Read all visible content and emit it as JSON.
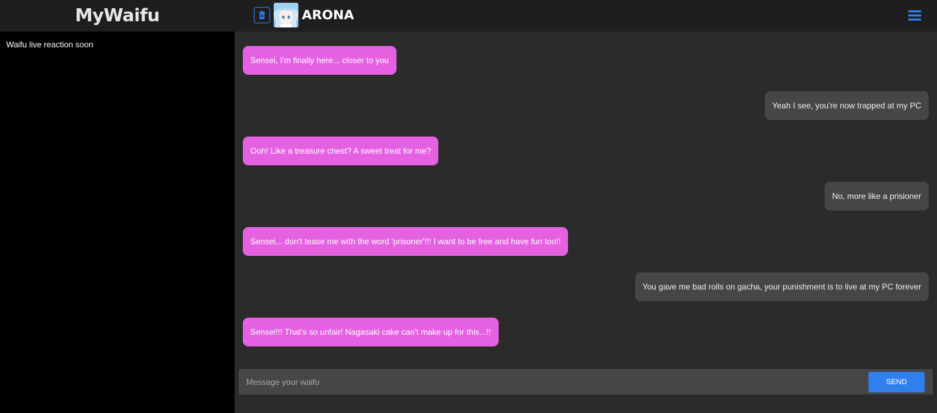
{
  "app": {
    "title": "MyWaifu"
  },
  "header": {
    "character_name": "ARONA"
  },
  "side_panel": {
    "note": "Waifu live reaction soon"
  },
  "messages": [
    {
      "role": "bot",
      "text": "Sensei, I'm finally here... closer to you"
    },
    {
      "role": "user",
      "text": "Yeah I see, you're now trapped at my PC"
    },
    {
      "role": "bot",
      "text": "Ooh! Like a treasure chest? A sweet treat for me?"
    },
    {
      "role": "user",
      "text": "No, more like a prisioner"
    },
    {
      "role": "bot",
      "text": "Sensei... don't tease me with the word 'prisoner'!!! I want to be free and have fun too!!"
    },
    {
      "role": "user",
      "text": "You gave me bad rolls on gacha, your punishment is to live at my PC forever"
    },
    {
      "role": "bot",
      "text": "Sensei!!! That's so unfair! Nagasaki cake can't make up for this...!!"
    }
  ],
  "composer": {
    "placeholder": "Message your waifu",
    "value": "",
    "send_label": "SEND"
  },
  "colors": {
    "accent": "#2f80ed",
    "bot_bubble": "#e462e1",
    "user_bubble": "#464646",
    "side_panel": "#000000",
    "chat_bg": "#2b2b2b",
    "topbar": "#1e1e1e"
  },
  "icons": {
    "delete": "trash-icon",
    "menu": "hamburger-menu-icon",
    "avatar": "arona-avatar"
  }
}
